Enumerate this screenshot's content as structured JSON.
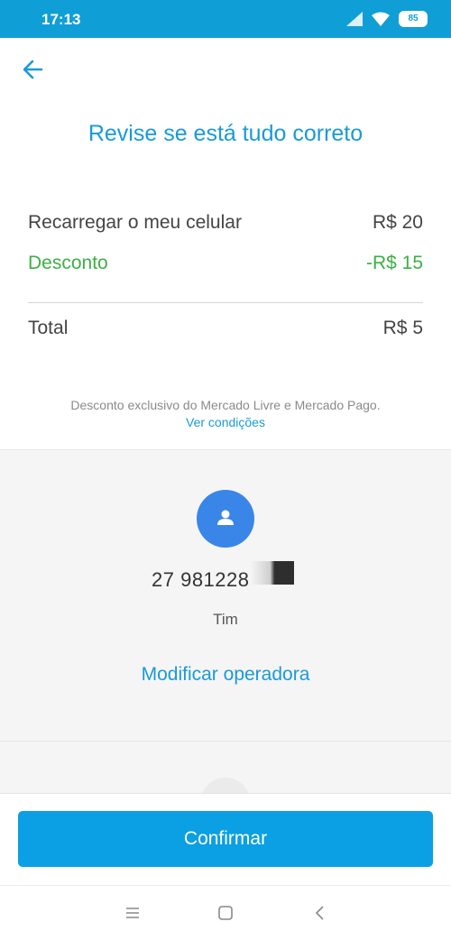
{
  "status_bar": {
    "time": "17:13",
    "battery": "85"
  },
  "header": {
    "title": "Revise se está tudo correto"
  },
  "summary": {
    "recharge_label": "Recarregar o meu celular",
    "recharge_value": "R$ 20",
    "discount_label": "Desconto",
    "discount_value": "-R$ 15",
    "total_label": "Total",
    "total_value": "R$ 5"
  },
  "disclaimer": {
    "text": "Desconto exclusivo do Mercado Livre e Mercado Pago.",
    "link": "Ver condições"
  },
  "recipient": {
    "phone": "27 981228",
    "operator": "Tim",
    "modify_label": "Modificar operadora"
  },
  "footer": {
    "confirm_label": "Confirmar"
  },
  "colors": {
    "accent": "#1a9ad9",
    "discount": "#3cb044",
    "button": "#0b9fe3",
    "avatar": "#3986e8"
  },
  "icons": [
    "arrow-left-icon",
    "person-icon",
    "signal-icon",
    "wifi-icon",
    "battery-icon",
    "menu-icon",
    "home-square-icon",
    "back-chevron-icon"
  ]
}
